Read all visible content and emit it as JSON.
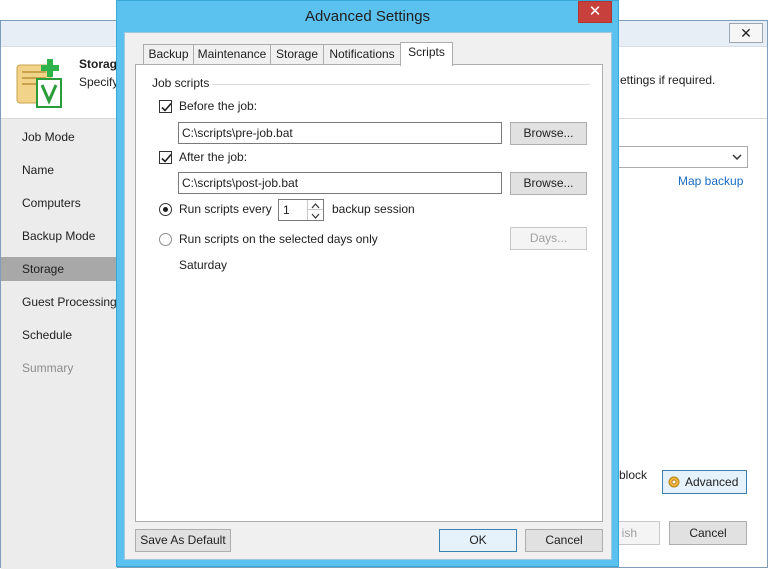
{
  "background_window": {
    "header": {
      "title": "Storage",
      "description": "Specify",
      "description_right": "ettings if required."
    },
    "nav": [
      {
        "label": "Job Mode",
        "state": "normal"
      },
      {
        "label": "Name",
        "state": "normal"
      },
      {
        "label": "Computers",
        "state": "normal"
      },
      {
        "label": "Backup Mode",
        "state": "normal"
      },
      {
        "label": "Storage",
        "state": "selected"
      },
      {
        "label": "Guest Processing",
        "state": "normal"
      },
      {
        "label": "Schedule",
        "state": "normal"
      },
      {
        "label": "Summary",
        "state": "disabled"
      }
    ],
    "map_backup_link": "Map backup",
    "block_text": "block",
    "advanced_button": "Advanced",
    "finish_button": "ish",
    "cancel_button": "Cancel",
    "close_glyph": "✕"
  },
  "dialog": {
    "title": "Advanced Settings",
    "close_glyph": "✕",
    "tabs": [
      {
        "label": "Backup",
        "active": false
      },
      {
        "label": "Maintenance",
        "active": false
      },
      {
        "label": "Storage",
        "active": false
      },
      {
        "label": "Notifications",
        "active": false
      },
      {
        "label": "Scripts",
        "active": true
      }
    ],
    "scripts": {
      "group_label": "Job scripts",
      "before_job": {
        "label": "Before the job:",
        "checked": true,
        "path": "C:\\scripts\\pre-job.bat",
        "browse_label": "Browse..."
      },
      "after_job": {
        "label": "After the job:",
        "checked": true,
        "path": "C:\\scripts\\post-job.bat",
        "browse_label": "Browse..."
      },
      "run_every": {
        "label": "Run scripts every",
        "value": "1",
        "suffix": "backup session",
        "selected": true
      },
      "run_days": {
        "label": "Run scripts on the selected days only",
        "days_label": "Days...",
        "selected": false
      },
      "days_value": "Saturday"
    },
    "footer": {
      "save_default": "Save As Default",
      "ok": "OK",
      "cancel": "Cancel"
    }
  },
  "colors": {
    "dialog_frame": "#5bc1ee",
    "close_red": "#c7403b",
    "link_blue": "#1a6bc2",
    "nav_selected": "#a8a8a8"
  }
}
